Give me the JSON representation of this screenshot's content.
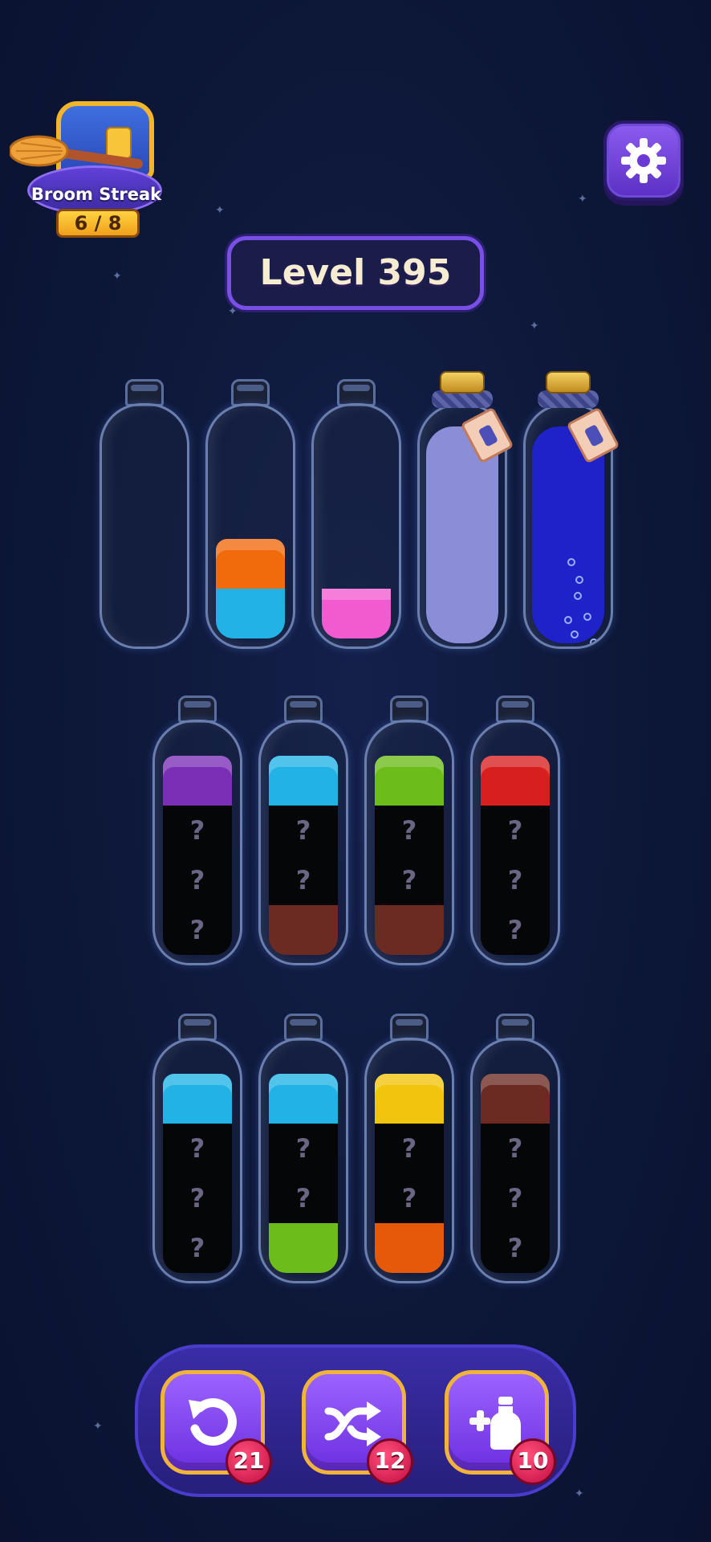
{
  "header": {
    "streak": {
      "label": "Broom Streak",
      "progress": "6 / 8"
    },
    "level_title": "Level 395",
    "settings_icon": "gear-icon"
  },
  "colors": {
    "orange": "#f16a0c",
    "cyan": "#22b3e6",
    "pink": "#f25ad0",
    "lavender": "#8b8ed6",
    "royal_blue": "#1f22c9",
    "purple": "#7a2fb6",
    "green": "#6cbc1a",
    "red": "#d81f1f",
    "brown": "#6b2a22",
    "yellow": "#f2c40e",
    "deep_orange": "#e55a0a"
  },
  "rows": [
    [
      {
        "state": "open",
        "layers": []
      },
      {
        "state": "open",
        "layers": [
          "orange",
          "cyan"
        ]
      },
      {
        "state": "open",
        "layers": [
          "pink"
        ]
      },
      {
        "state": "sealed",
        "layers": [
          "lavender"
        ]
      },
      {
        "state": "sealed",
        "layers": [
          "royal_blue"
        ]
      }
    ],
    [
      {
        "state": "open",
        "layers": [
          "purple",
          "?",
          "?",
          "?"
        ]
      },
      {
        "state": "open",
        "layers": [
          "cyan",
          "?",
          "?",
          "brown"
        ]
      },
      {
        "state": "open",
        "layers": [
          "green",
          "?",
          "?",
          "brown"
        ]
      },
      {
        "state": "open",
        "layers": [
          "red",
          "?",
          "?",
          "?"
        ]
      }
    ],
    [
      {
        "state": "open",
        "layers": [
          "cyan",
          "?",
          "?",
          "?"
        ]
      },
      {
        "state": "open",
        "layers": [
          "cyan",
          "?",
          "?",
          "green"
        ]
      },
      {
        "state": "open",
        "layers": [
          "yellow",
          "?",
          "?",
          "deep_orange"
        ]
      },
      {
        "state": "open",
        "layers": [
          "brown",
          "?",
          "?",
          "?"
        ]
      }
    ]
  ],
  "hidden_mark": "?",
  "toolbar": {
    "undo": {
      "icon": "undo-icon",
      "count": "21"
    },
    "shuffle": {
      "icon": "shuffle-icon",
      "count": "12"
    },
    "add_bottle": {
      "icon": "add-bottle-icon",
      "count": "10"
    }
  }
}
